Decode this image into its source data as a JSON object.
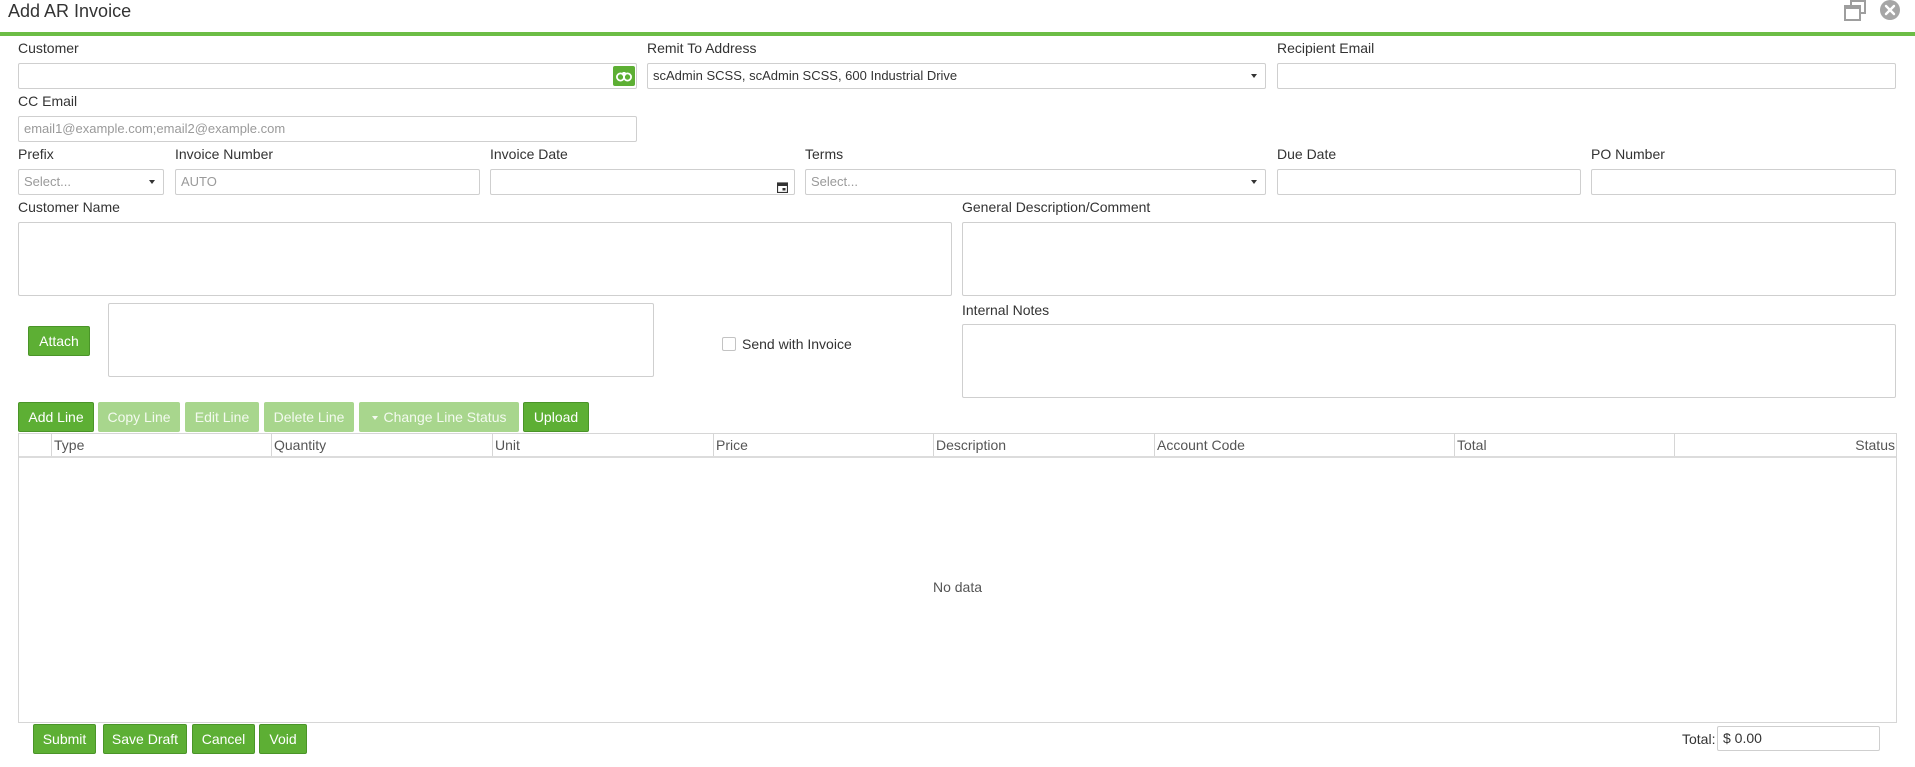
{
  "window": {
    "title": "Add AR Invoice",
    "restore_icon": "restore-window-icon",
    "close_icon": "close-icon"
  },
  "colors": {
    "accent": "#5daf34",
    "accent_disabled": "#a8d68d",
    "border": "#cfcfcf"
  },
  "fields": {
    "customer": {
      "label": "Customer",
      "value": "",
      "lookup_icon": "binoculars-icon"
    },
    "remit_to": {
      "label": "Remit To Address",
      "value": "scAdmin SCSS, scAdmin SCSS, 600 Industrial Drive"
    },
    "recipient_email": {
      "label": "Recipient Email",
      "value": ""
    },
    "cc_email": {
      "label": "CC Email",
      "placeholder": "email1@example.com;email2@example.com"
    },
    "prefix": {
      "label": "Prefix",
      "placeholder": "Select..."
    },
    "invoice_number": {
      "label": "Invoice Number",
      "placeholder": "AUTO"
    },
    "invoice_date": {
      "label": "Invoice Date",
      "value": "",
      "icon": "calendar-icon"
    },
    "terms": {
      "label": "Terms",
      "placeholder": "Select..."
    },
    "due_date": {
      "label": "Due Date",
      "value": ""
    },
    "po_number": {
      "label": "PO Number",
      "value": ""
    },
    "customer_name": {
      "label": "Customer Name"
    },
    "general_description": {
      "label": "General Description/Comment"
    },
    "internal_notes": {
      "label": "Internal Notes"
    }
  },
  "attachments": {
    "attach_label": "Attach",
    "send_with_invoice_label": "Send with Invoice",
    "send_with_invoice_checked": false
  },
  "toolbar": {
    "add_line": "Add Line",
    "copy_line": "Copy Line",
    "edit_line": "Edit Line",
    "delete_line": "Delete Line",
    "change_line_status": "Change Line Status",
    "upload": "Upload"
  },
  "grid": {
    "columns": [
      "Type",
      "Quantity",
      "Unit",
      "Price",
      "Description",
      "Account Code",
      "Total",
      "Status"
    ],
    "empty_text": "No data"
  },
  "footer": {
    "submit": "Submit",
    "save_draft": "Save Draft",
    "cancel": "Cancel",
    "void": "Void",
    "total_label": "Total:",
    "total_value": "$ 0.00"
  }
}
